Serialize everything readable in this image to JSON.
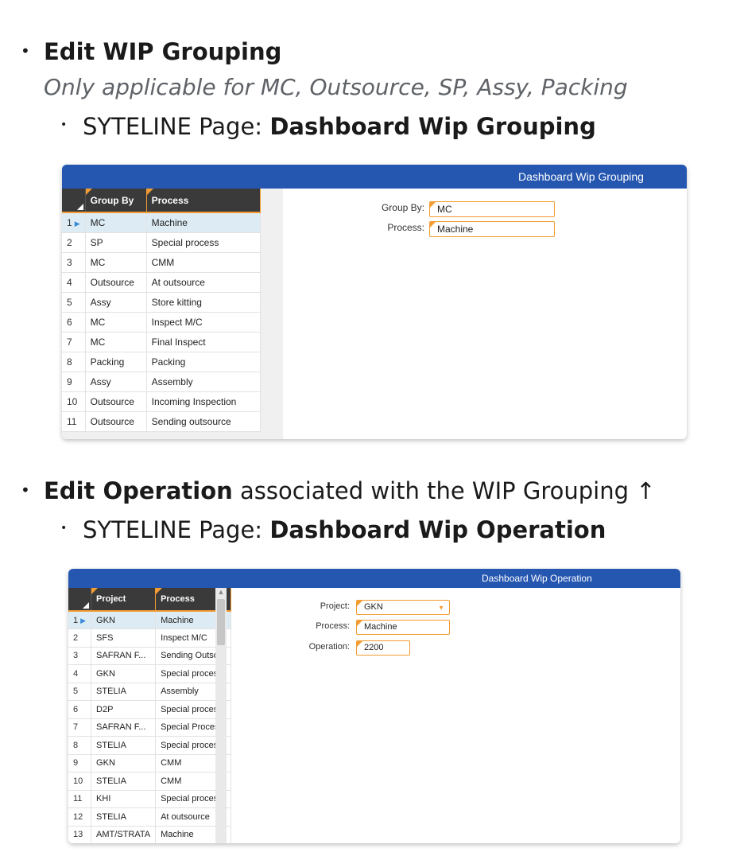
{
  "section1": {
    "heading": "Edit WIP Grouping",
    "note": "Only applicable for MC, Outsource, SP, Assy, Packing",
    "page_prefix": "SYTELINE Page: ",
    "page_name": "Dashboard Wip Grouping"
  },
  "app1": {
    "title": "Dashboard Wip Grouping",
    "columns": [
      "Group By",
      "Process"
    ],
    "rows": [
      [
        "1",
        "MC",
        "Machine"
      ],
      [
        "2",
        "SP",
        "Special process"
      ],
      [
        "3",
        "MC",
        "CMM"
      ],
      [
        "4",
        "Outsource",
        "At outsource"
      ],
      [
        "5",
        "Assy",
        "Store kitting"
      ],
      [
        "6",
        "MC",
        "Inspect M/C"
      ],
      [
        "7",
        "MC",
        "Final Inspect"
      ],
      [
        "8",
        "Packing",
        "Packing"
      ],
      [
        "9",
        "Assy",
        "Assembly"
      ],
      [
        "10",
        "Outsource",
        "Incoming Inspection"
      ],
      [
        "11",
        "Outsource",
        "Sending outsource"
      ]
    ],
    "form": {
      "group_by_label": "Group By:",
      "group_by_value": "MC",
      "process_label": "Process:",
      "process_value": "Machine"
    }
  },
  "section2": {
    "heading_strong": "Edit Operation",
    "heading_rest": " associated with the WIP Grouping ↑",
    "page_prefix": "SYTELINE Page: ",
    "page_name": "Dashboard Wip Operation"
  },
  "app2": {
    "title": "Dashboard Wip Operation",
    "columns": [
      "Project",
      "Process"
    ],
    "rows": [
      [
        "1",
        "GKN",
        "Machine"
      ],
      [
        "2",
        "SFS",
        "Inspect M/C"
      ],
      [
        "3",
        "SAFRAN F...",
        "Sending Outso..."
      ],
      [
        "4",
        "GKN",
        "Special process"
      ],
      [
        "5",
        "STELIA",
        "Assembly"
      ],
      [
        "6",
        "D2P",
        "Special process"
      ],
      [
        "7",
        "SAFRAN F...",
        "Special Process"
      ],
      [
        "8",
        "STELIA",
        "Special process"
      ],
      [
        "9",
        "GKN",
        "CMM"
      ],
      [
        "10",
        "STELIA",
        "CMM"
      ],
      [
        "11",
        "KHI",
        "Special process"
      ],
      [
        "12",
        "STELIA",
        "At outsource"
      ],
      [
        "13",
        "AMT/STRATA",
        "Machine"
      ]
    ],
    "form": {
      "project_label": "Project:",
      "project_value": "GKN",
      "process_label": "Process:",
      "process_value": "Machine",
      "operation_label": "Operation:",
      "operation_value": "2200"
    }
  },
  "colors": {
    "titlebar": "#2557b1",
    "accent": "#f39c32",
    "selected_row": "#ddecf4"
  }
}
